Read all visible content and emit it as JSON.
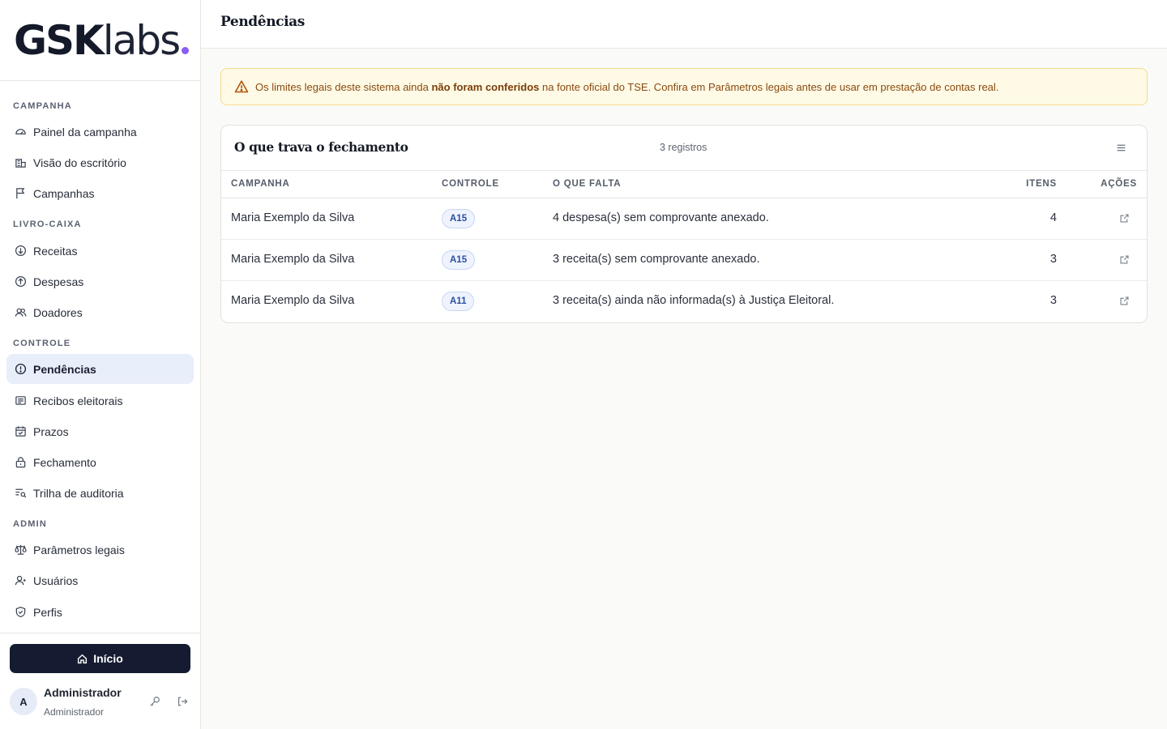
{
  "logo": {
    "bold": "GSK",
    "light": "labs"
  },
  "sidebar": {
    "sections": [
      {
        "title": "CAMPANHA",
        "items": [
          {
            "label": "Painel da campanha",
            "icon": "gauge-icon"
          },
          {
            "label": "Visão do escritório",
            "icon": "building-icon"
          },
          {
            "label": "Campanhas",
            "icon": "flag-icon"
          }
        ]
      },
      {
        "title": "LIVRO-CAIXA",
        "items": [
          {
            "label": "Receitas",
            "icon": "arrow-down-circle-icon"
          },
          {
            "label": "Despesas",
            "icon": "arrow-up-circle-icon"
          },
          {
            "label": "Doadores",
            "icon": "users-icon"
          }
        ]
      },
      {
        "title": "CONTROLE",
        "items": [
          {
            "label": "Pendências",
            "icon": "alert-circle-icon",
            "active": true
          },
          {
            "label": "Recibos eleitorais",
            "icon": "receipt-icon"
          },
          {
            "label": "Prazos",
            "icon": "calendar-check-icon"
          },
          {
            "label": "Fechamento",
            "icon": "lock-icon"
          },
          {
            "label": "Trilha de auditoria",
            "icon": "list-search-icon"
          }
        ]
      },
      {
        "title": "ADMIN",
        "items": [
          {
            "label": "Parâmetros legais",
            "icon": "scale-icon"
          },
          {
            "label": "Usuários",
            "icon": "user-plus-icon"
          },
          {
            "label": "Perfis",
            "icon": "shield-check-icon"
          }
        ]
      }
    ],
    "home_button": "Início",
    "user": {
      "initial": "A",
      "name": "Administrador",
      "role": "Administrador"
    }
  },
  "header": {
    "title": "Pendências"
  },
  "alert": {
    "prefix": "Os limites legais deste sistema ainda ",
    "bold": "não foram conferidos",
    "suffix": " na fonte oficial do TSE. Confira em Parâmetros legais antes de usar em prestação de contas real."
  },
  "card": {
    "title": "O que trava o fechamento",
    "count": "3 registros",
    "columns": [
      "CAMPANHA",
      "CONTROLE",
      "O QUE FALTA",
      "ITENS",
      "AÇÕES"
    ],
    "rows": [
      {
        "campanha": "Maria Exemplo da Silva",
        "controle": "A15",
        "falta": "4 despesa(s) sem comprovante anexado.",
        "itens": "4"
      },
      {
        "campanha": "Maria Exemplo da Silva",
        "controle": "A15",
        "falta": "3 receita(s) sem comprovante anexado.",
        "itens": "3"
      },
      {
        "campanha": "Maria Exemplo da Silva",
        "controle": "A11",
        "falta": "3 receita(s) ainda não informada(s) à Justiça Eleitoral.",
        "itens": "3"
      }
    ]
  },
  "colors": {
    "accent": "#8b5cf6",
    "primary": "#151c31",
    "active_bg": "#e9eefb",
    "alert_bg": "#fefae6",
    "alert_text": "#8b4a0f"
  }
}
